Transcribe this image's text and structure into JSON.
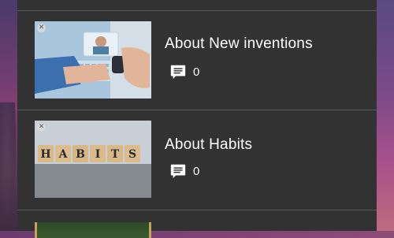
{
  "articles": [
    {
      "title": "About New inventions",
      "comment_count": "0",
      "thumbnail": "smartwatch-video-call-image"
    },
    {
      "title": "About Habits",
      "comment_count": "0",
      "thumbnail": "habits-wooden-blocks-image"
    }
  ],
  "habits_letters": [
    "H",
    "A",
    "B",
    "I",
    "T",
    "S"
  ],
  "colors": {
    "panel": "#323232",
    "divider": "#5a5a5a",
    "text": "#ffffff"
  },
  "icons": {
    "comment": "comment-icon",
    "close": "close-icon"
  }
}
